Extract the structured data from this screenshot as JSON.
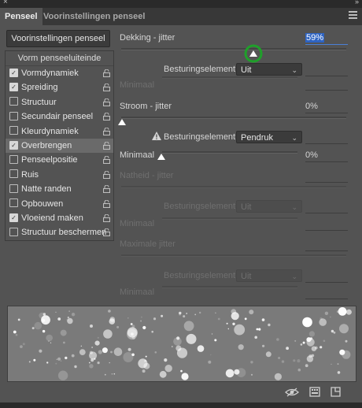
{
  "window": {
    "close_symbol": "×",
    "collapse_symbol": "»"
  },
  "tabs": [
    {
      "label": "Penseel"
    },
    {
      "label": "Voorinstellingen penseel"
    }
  ],
  "preset_button": {
    "label": "Voorinstellingen penseel"
  },
  "list": {
    "header": "Vorm penseeluiteinde",
    "items": [
      {
        "label": "Vormdynamiek",
        "checked": true
      },
      {
        "label": "Spreiding",
        "checked": true
      },
      {
        "label": "Structuur",
        "checked": false
      },
      {
        "label": "Secundair penseel",
        "checked": false
      },
      {
        "label": "Kleurdynamiek",
        "checked": false
      },
      {
        "label": "Overbrengen",
        "checked": true,
        "selected": true
      },
      {
        "label": "Penseelpositie",
        "checked": false
      },
      {
        "label": "Ruis",
        "checked": false
      },
      {
        "label": "Natte randen",
        "checked": false
      },
      {
        "label": "Opbouwen",
        "checked": false
      },
      {
        "label": "Vloeiend maken",
        "checked": true
      },
      {
        "label": "Structuur beschermen",
        "checked": false
      }
    ]
  },
  "opacity": {
    "label": "Dekking - jitter",
    "value": "59%",
    "percent": 59,
    "control_label": "Besturingselement:",
    "control_value": "Uit",
    "min_label": "Minimaal"
  },
  "flow": {
    "label": "Stroom - jitter",
    "value": "0%",
    "control_label": "Besturingselement:",
    "control_value": "Pendruk",
    "min_label": "Minimaal",
    "min_value": "0%"
  },
  "wetness": {
    "label": "Natheid - jitter",
    "control_label": "Besturingselement:",
    "control_value": "Uit",
    "min_label": "Minimaal"
  },
  "mix": {
    "label": "Maximale jitter",
    "control_label": "Besturingselement:",
    "control_value": "Uit",
    "min_label": "Minimaal"
  },
  "icons": {
    "checkbox_check": "✓",
    "chevron": "⌄"
  }
}
